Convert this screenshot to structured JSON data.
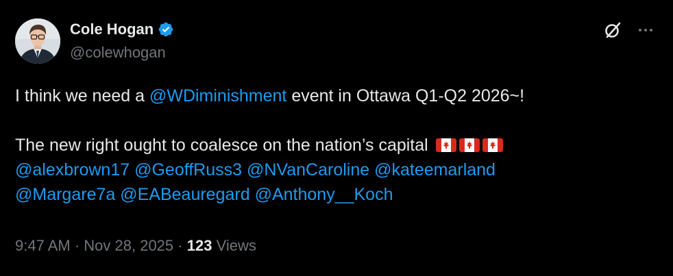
{
  "author": {
    "display_name": "Cole Hogan",
    "handle": "@colewhogan",
    "verified": true,
    "verified_color": "#1d9bf0"
  },
  "actions": {
    "grok_icon": "grok-slash-circle-icon",
    "more_icon": "more-dots-icon"
  },
  "body": {
    "line1_prefix": "I think we need a ",
    "line1_mention": "@WDiminishment",
    "line1_suffix": " event in Ottawa Q1-Q2 2026~!",
    "line2_text": "The new right ought to coalesce on the nation’s capital",
    "flags": [
      "canada-flag-icon",
      "canada-flag-icon",
      "canada-flag-icon"
    ],
    "mentions_row1": [
      "@alexbrown17",
      "@GeoffRuss3",
      "@NVanCaroline",
      "@kateemarland"
    ],
    "mentions_row2": [
      "@Margare7a",
      "@EABeauregard",
      "@Anthony__Koch"
    ]
  },
  "meta": {
    "time": "9:47 AM",
    "date": "Nov 28, 2025",
    "views_count": "123",
    "views_label": "Views"
  },
  "colors": {
    "background": "#000000",
    "text": "#e7e9ea",
    "secondary": "#71767b",
    "link": "#1d9bf0"
  }
}
